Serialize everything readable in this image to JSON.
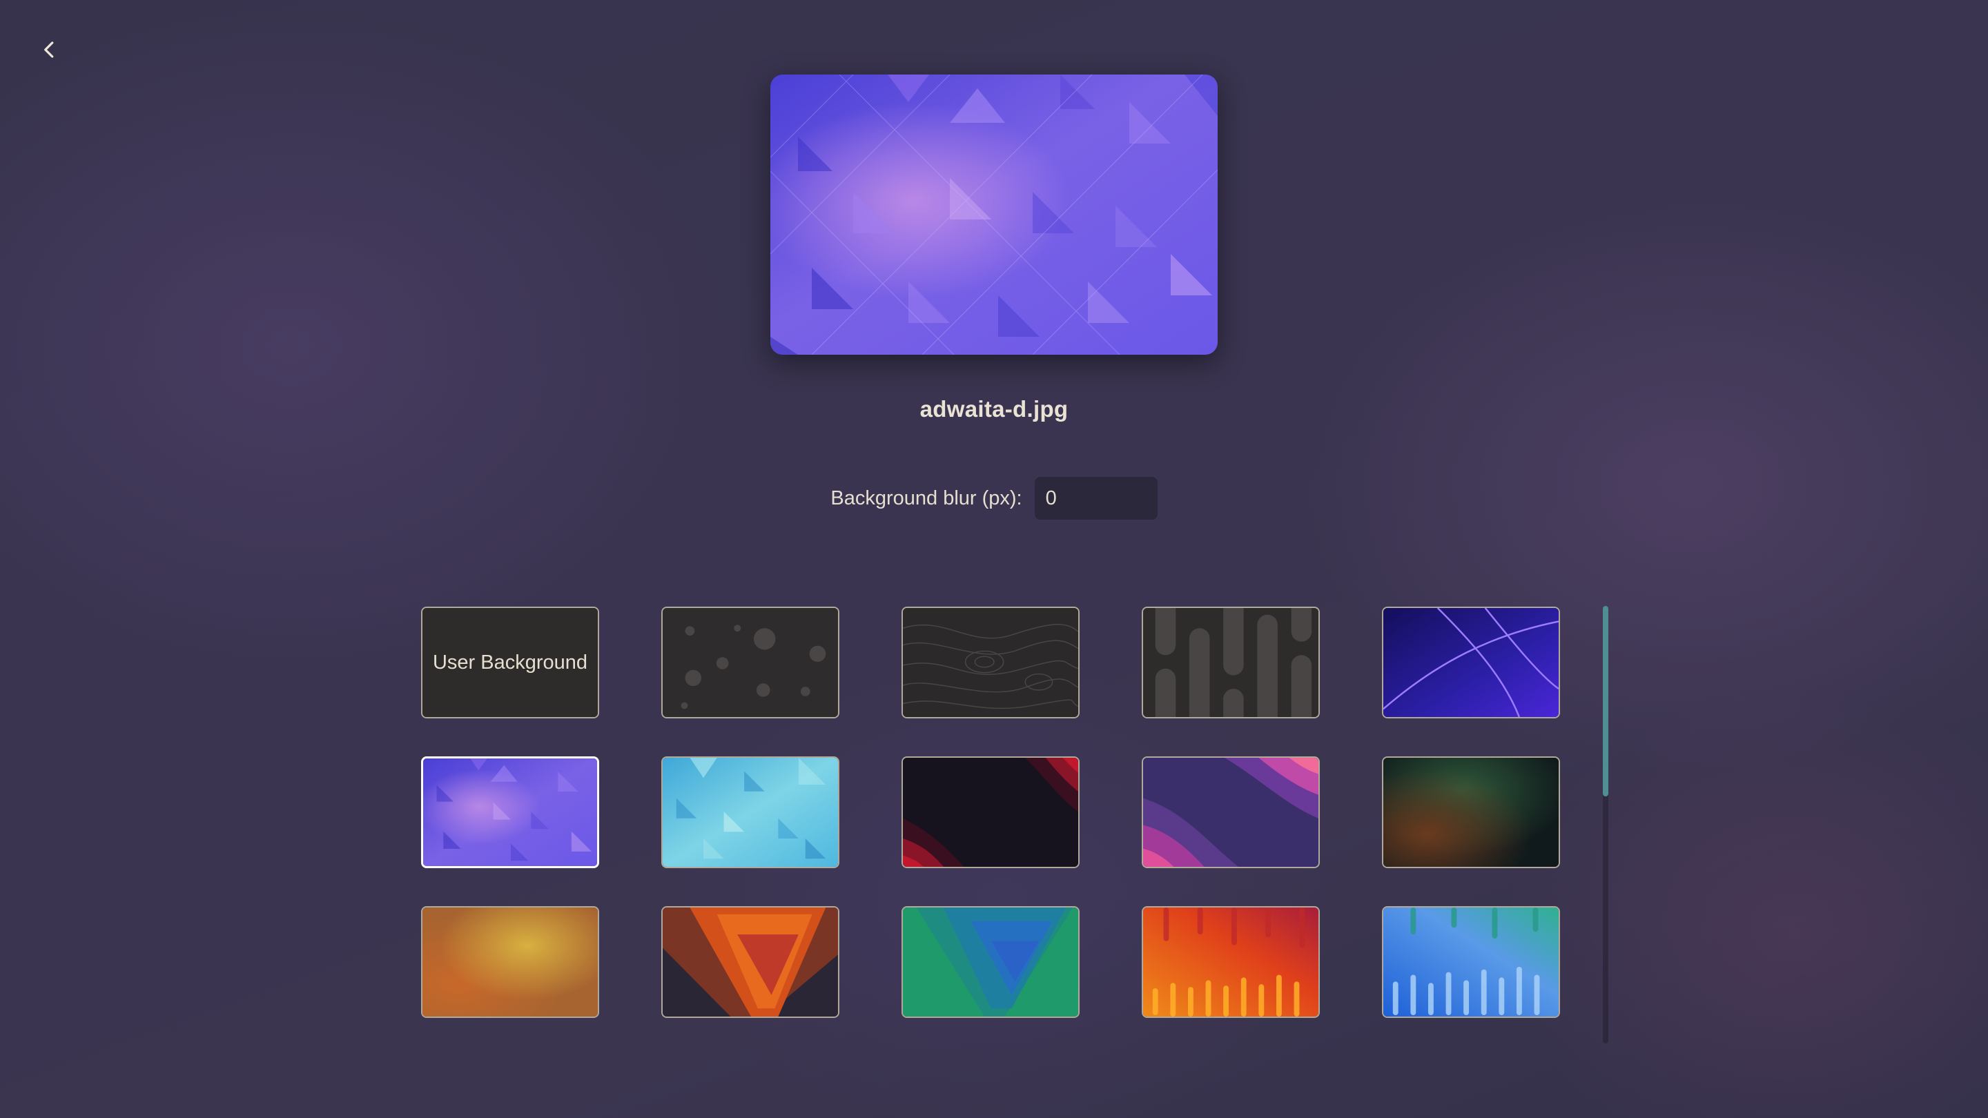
{
  "nav": {
    "back_icon": "chevron-left-icon"
  },
  "preview": {
    "selected_file": "adwaita-d.jpg"
  },
  "blur": {
    "label": "Background blur (px):",
    "value": "0"
  },
  "gallery": {
    "user_background_label": "User Background",
    "wallpapers": [
      "user-background",
      "dark-dots",
      "dark-topographic",
      "dark-pills",
      "blue-purple-lines",
      "adwaita-purple-triangles",
      "cyan-triangles",
      "dark-red-waves",
      "purple-magenta-waves",
      "dark-green-blur",
      "amber-blur",
      "red-orange-triangle",
      "green-blue-triangle",
      "orange-drips",
      "blue-drips"
    ],
    "selected_index": 5
  },
  "colors": {
    "text": "#e6dfd0",
    "scrollbar_accent": "#4f8f93",
    "selected_border": "#ffffff"
  }
}
